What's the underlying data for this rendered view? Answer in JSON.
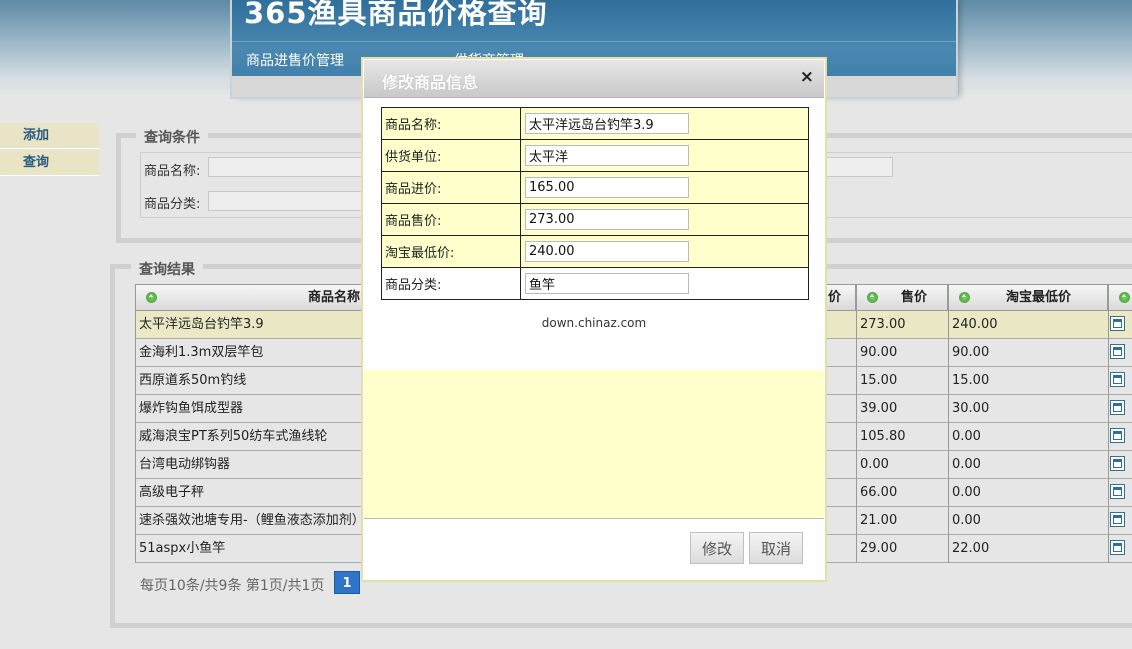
{
  "header": {
    "title": "365渔具商品价格查询",
    "nav": [
      "商品进售价管理",
      "供货商管理"
    ]
  },
  "sidebar": {
    "items": [
      {
        "label": "添加"
      },
      {
        "label": "查询"
      }
    ]
  },
  "query": {
    "legend": "查询条件",
    "name_label": "商品名称:",
    "category_label": "商品分类:"
  },
  "results": {
    "legend": "查询结果",
    "columns": [
      "商品名称",
      "价",
      "售价",
      "淘宝最低价"
    ],
    "rows": [
      {
        "name": "太平洋远岛台钓竿3.9",
        "sale": "273.00",
        "taobao": "240.00"
      },
      {
        "name": "金海利1.3m双层竿包",
        "sale": "90.00",
        "taobao": "90.00"
      },
      {
        "name": "西原道系50m钓线",
        "sale": "15.00",
        "taobao": "15.00"
      },
      {
        "name": "爆炸钩鱼饵成型器",
        "sale": "39.00",
        "taobao": "30.00"
      },
      {
        "name": "威海浪宝PT系列50纺车式渔线轮",
        "sale": "105.80",
        "taobao": "0.00"
      },
      {
        "name": "台湾电动绑钩器",
        "sale": "0.00",
        "taobao": "0.00"
      },
      {
        "name": "高级电子秤",
        "sale": "66.00",
        "taobao": "0.00"
      },
      {
        "name": "速杀强效池塘专用-（鲤鱼液态添加剂）",
        "sale": "21.00",
        "taobao": "0.00"
      },
      {
        "name": "51aspx小鱼竿",
        "sale": "29.00",
        "taobao": "22.00"
      }
    ],
    "pager_text": "每页10条/共9条 第1页/共1页",
    "current_page": "1"
  },
  "modal": {
    "title": "修改商品信息",
    "close": "×",
    "fields": [
      {
        "label": "商品名称:",
        "value": "太平洋远岛台钓竿3.9"
      },
      {
        "label": "供货单位:",
        "value": "太平洋"
      },
      {
        "label": "商品进价:",
        "value": "165.00"
      },
      {
        "label": "商品售价:",
        "value": "273.00"
      },
      {
        "label": "淘宝最低价:",
        "value": "240.00"
      },
      {
        "label": "商品分类:",
        "value": "鱼竿"
      }
    ],
    "watermark": "down.chinaz.com",
    "submit_label": "修改",
    "cancel_label": "取消"
  },
  "colors": {
    "header_blue": "#3a7aa5",
    "highlight_row": "#ebe9c5",
    "modal_yellow": "#ffffcc",
    "page_blue": "#2e75c7"
  }
}
